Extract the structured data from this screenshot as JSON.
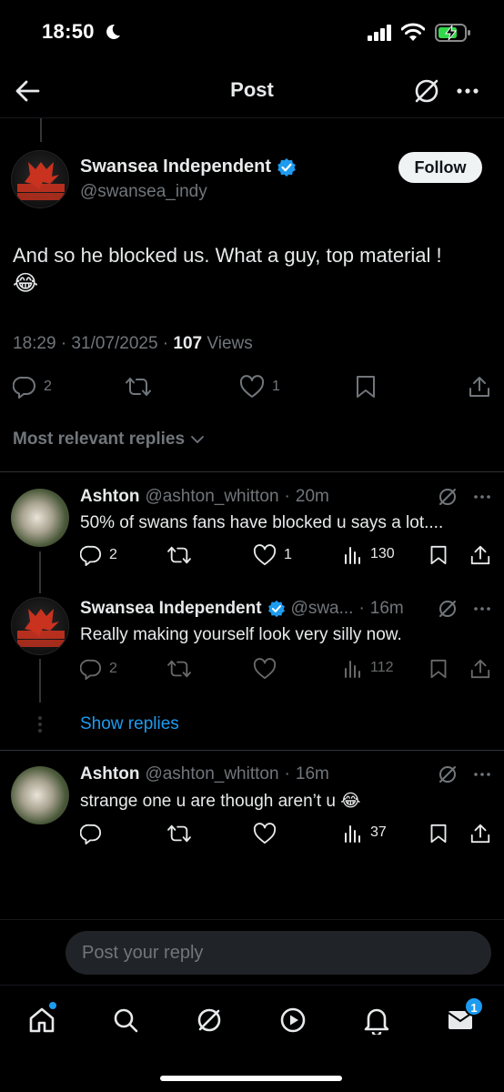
{
  "status_bar": {
    "time": "18:50"
  },
  "header": {
    "title": "Post"
  },
  "main_post": {
    "author_name": "Swansea Independent",
    "handle": "@swansea_indy",
    "follow_label": "Follow",
    "text": "And so he blocked us. What a guy, top material !",
    "emoji": "😂",
    "time": "18:29 · 31/07/2025 · ",
    "views_count": "107",
    "views_label": " Views",
    "replies": "2",
    "reposts": "",
    "likes": "1"
  },
  "relevant_label": "Most relevant replies",
  "replies": [
    {
      "name": "Ashton",
      "handle": "@ashton_whitton",
      "dot": "·",
      "time": "20m",
      "text": "50% of swans fans have blocked u says a lot....",
      "replies": "2",
      "likes": "1",
      "views": "130"
    },
    {
      "name": "Swansea Independent",
      "handle": "@swa...",
      "dot": "·",
      "time": "16m",
      "text": "Really making yourself look very silly now.",
      "replies": "2",
      "likes": "",
      "views": "112"
    },
    {
      "name": "Ashton",
      "handle": "@ashton_whitton",
      "dot": "·",
      "time": "16m",
      "text": "strange one u are though aren’t u",
      "emoji": "😂",
      "replies": "",
      "likes": "",
      "views": "37"
    }
  ],
  "show_replies_label": "Show replies",
  "reply_bar": {
    "placeholder": "Post your reply"
  },
  "bottom_nav": {
    "messages_badge": "1"
  },
  "colors": {
    "accent": "#1d9bf0",
    "background": "#000000",
    "muted": "#71767b",
    "text": "#e7e9ea"
  }
}
